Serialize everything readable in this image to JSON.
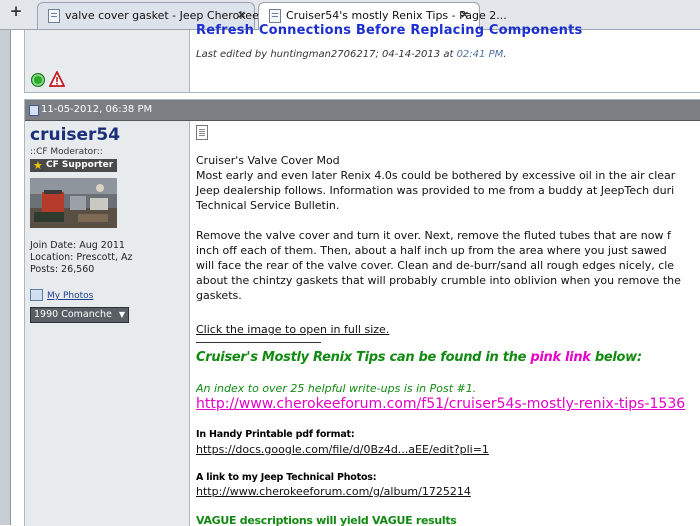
{
  "browser": {
    "new_tab_glyph": "+",
    "tabs": [
      {
        "title": "valve cover gasket - Jeep Cherokee F...",
        "active": false,
        "close": "×"
      },
      {
        "title": "Cruiser54's mostly Renix Tips - Page 2...",
        "active": true,
        "close": "×"
      }
    ]
  },
  "previous_post": {
    "heading_fragment": "Refresh Connections Before Replacing Components",
    "edited_prefix": "Last edited by huntingman2706217; 04-14-2013 at",
    "edited_time": "02:41 PM",
    "edited_suffix": ".",
    "status_icon": "online-icon",
    "report_icon": "report-warning-icon"
  },
  "post": {
    "date": "11-05-2012, 06:38 PM",
    "user": {
      "name": "cruiser54",
      "title": "::CF Moderator::",
      "badge": "CF Supporter",
      "badge_icon": "star-icon",
      "join_date": "Join Date: Aug 2011",
      "location": "Location: Prescott, Az",
      "posts": "Posts: 26,560",
      "photos_label": "My Photos",
      "vehicle": "1990 Comanche",
      "vehicle_arrow": "▼"
    },
    "body": {
      "lines": [
        "Cruiser's Valve Cover Mod",
        "Most early and even later Renix 4.0s could be bothered by excessive oil in the air clear",
        "Jeep dealership follows. Information was provided to me from a buddy at JeepTech duri",
        "Technical Service Bulletin."
      ],
      "lines2": [
        "Remove the valve cover and turn it over. Next, remove the fluted tubes that are now f",
        "inch off each of them. Then, about a half inch up from the area where you just sawed",
        "will face the rear of the valve cover. Clean and de-burr/sand all rough edges nicely, cle",
        "about the chintzy gaskets that will probably crumble into oblivion when you remove the",
        "gaskets."
      ],
      "click_image": "Click the image to open in full size.",
      "tips_prefix": "Cruiser's Mostly Renix Tips can be found in the ",
      "tips_pink": "pink link",
      "tips_suffix": " below:",
      "index_line": "An index to over 25 helpful write-ups is in Post #1.",
      "big_link": "http://www.cherokeeforum.com/f51/cruiser54s-mostly-renix-tips-1536",
      "pdf_heading": "In Handy Printable pdf format:",
      "pdf_link": "https://docs.google.com/file/d/0Bz4d...aEE/edit?pli=1",
      "photos_heading": "A link to my Jeep Technical Photos:",
      "photos_link": "http://www.cherokeeforum.com/g/album/1725214",
      "vague_line": "VAGUE descriptions will yield VAGUE results"
    }
  },
  "colors": {
    "heading_blue": "#1c2fcf",
    "header_gray": "#7b7e82",
    "green": "#128a12",
    "pink": "#e600c8"
  }
}
